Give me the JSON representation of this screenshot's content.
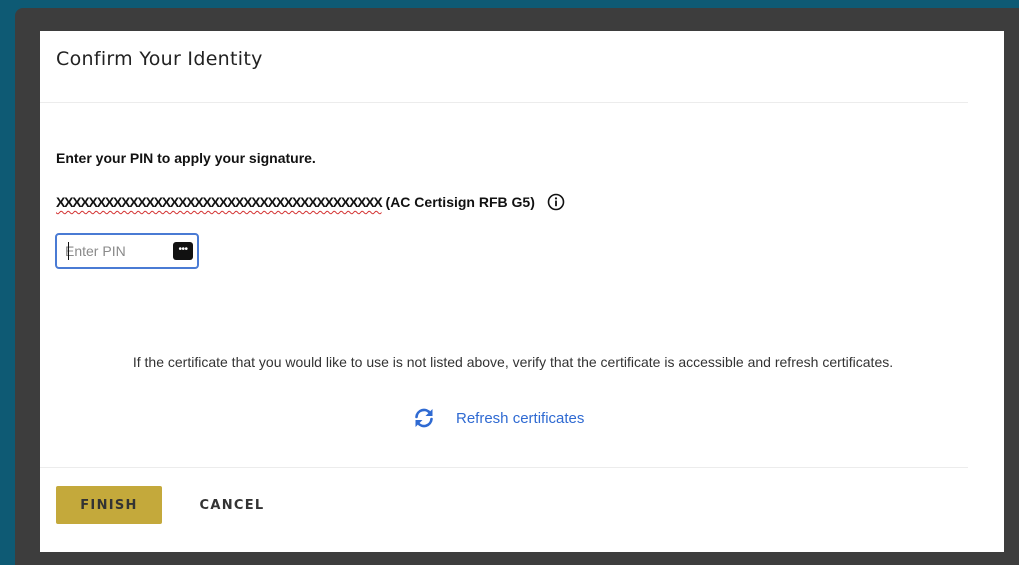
{
  "dialog": {
    "title": "Confirm Your Identity",
    "instruction": "Enter your PIN to apply your signature.",
    "certificate": {
      "name": "XXXXXXXXXXXXXXXXXXXXXXXXXXXXXXXXXXXXXXXX",
      "issuer": "(AC Certisign RFB G5)",
      "info_icon": "info-circle-icon"
    },
    "pin": {
      "placeholder": "Enter PIN",
      "value": "",
      "password_manager_icon": "ellipsis-key-icon",
      "password_manager_glyph": "•••"
    },
    "help_text": "If the certificate that you would like to use is not listed above, verify that the certificate is accessible and refresh certificates.",
    "refresh": {
      "label": "Refresh certificates",
      "icon": "refresh-icon"
    },
    "buttons": {
      "finish": "FINISH",
      "cancel": "CANCEL"
    }
  },
  "colors": {
    "background": "#0e5a74",
    "frame": "#3d3d3d",
    "accent_gold": "#c4a93b",
    "link_blue": "#2f6ad2",
    "input_border": "#4a7bd4"
  }
}
